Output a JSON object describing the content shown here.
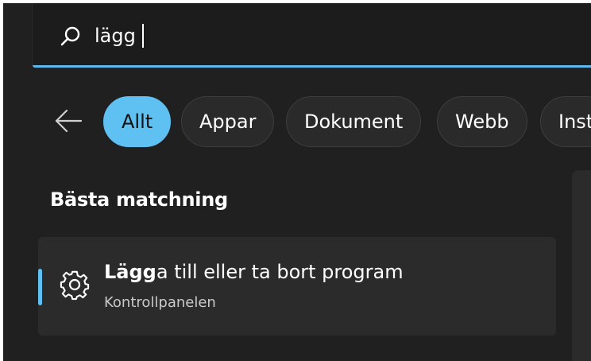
{
  "search": {
    "query": "lägg"
  },
  "filters": {
    "items": [
      {
        "label": "Allt",
        "active": true
      },
      {
        "label": "Appar",
        "active": false
      },
      {
        "label": "Dokument",
        "active": false
      },
      {
        "label": "Webb",
        "active": false
      },
      {
        "label": "Inst",
        "active": false
      }
    ]
  },
  "best_match": {
    "heading": "Bästa matchning",
    "result": {
      "title_match": "Lägg",
      "title_rest": "a till eller ta bort program",
      "subtitle": "Kontrollpanelen",
      "icon": "gear-icon"
    }
  },
  "colors": {
    "accent": "#5fc0f2",
    "background": "#202020",
    "card": "#2b2b2b"
  }
}
